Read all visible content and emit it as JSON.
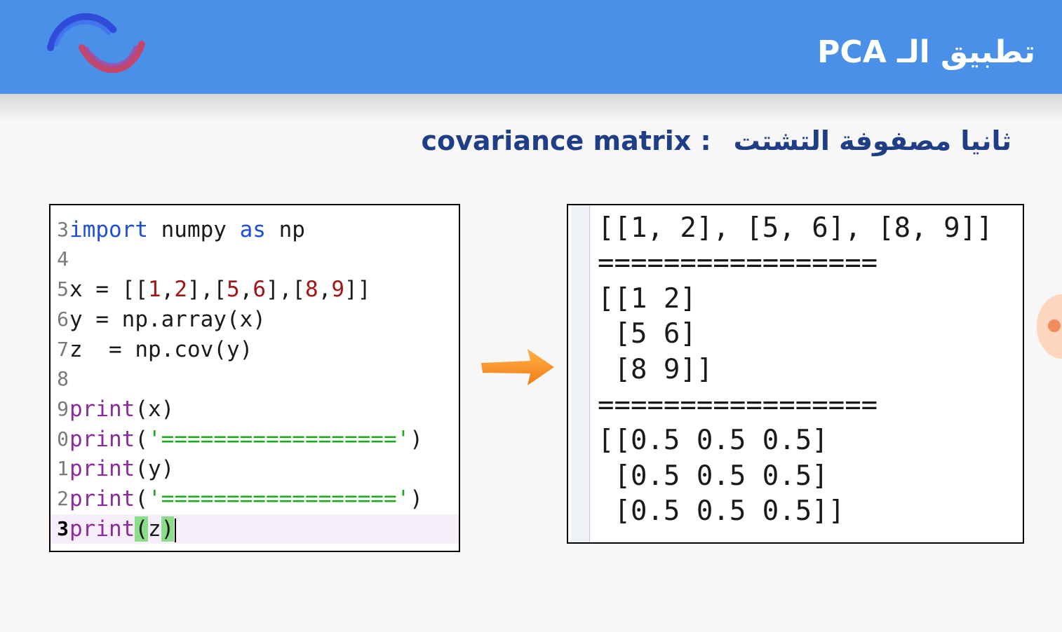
{
  "header": {
    "title": "تطبيق الـ PCA",
    "color": "#4a90e8"
  },
  "subtitle": {
    "arabic": "ثانيا مصفوفة التشتت",
    "english": ": covariance matrix"
  },
  "code_editor": {
    "lines": [
      {
        "number": "3",
        "code": "import numpy as np"
      },
      {
        "number": "4",
        "code": ""
      },
      {
        "number": "5",
        "code": "x = [[1,2],[5,6],[8,9]]"
      },
      {
        "number": "6",
        "code": "y = np.array(x)"
      },
      {
        "number": "7",
        "code": "z  = np.cov(y)"
      },
      {
        "number": "8",
        "code": ""
      },
      {
        "number": "9",
        "code": "print(x)"
      },
      {
        "number": "0",
        "code": "print('=================')"
      },
      {
        "number": "1",
        "code": "print(y)"
      },
      {
        "number": "2",
        "code": "print('=================')"
      },
      {
        "number": "3",
        "code": "print(z)"
      }
    ]
  },
  "output_console": {
    "lines": [
      "[[1, 2], [5, 6], [8, 9]]",
      "=================",
      "[[1 2]",
      " [5 6]",
      " [8 9]]",
      "=================",
      "[[0.5 0.5 0.5]",
      " [0.5 0.5 0.5]",
      " [0.5 0.5 0.5]]"
    ]
  },
  "icons": {
    "logo": "pca-logo-icon",
    "arrow": "arrow-right-icon"
  },
  "colors": {
    "keyword": "#1f4fd4",
    "builtin": "#8b2c9c",
    "number": "#a31515",
    "string": "#1ea81e",
    "arrow": "#f7941d",
    "subtitle": "#1f3e86"
  }
}
